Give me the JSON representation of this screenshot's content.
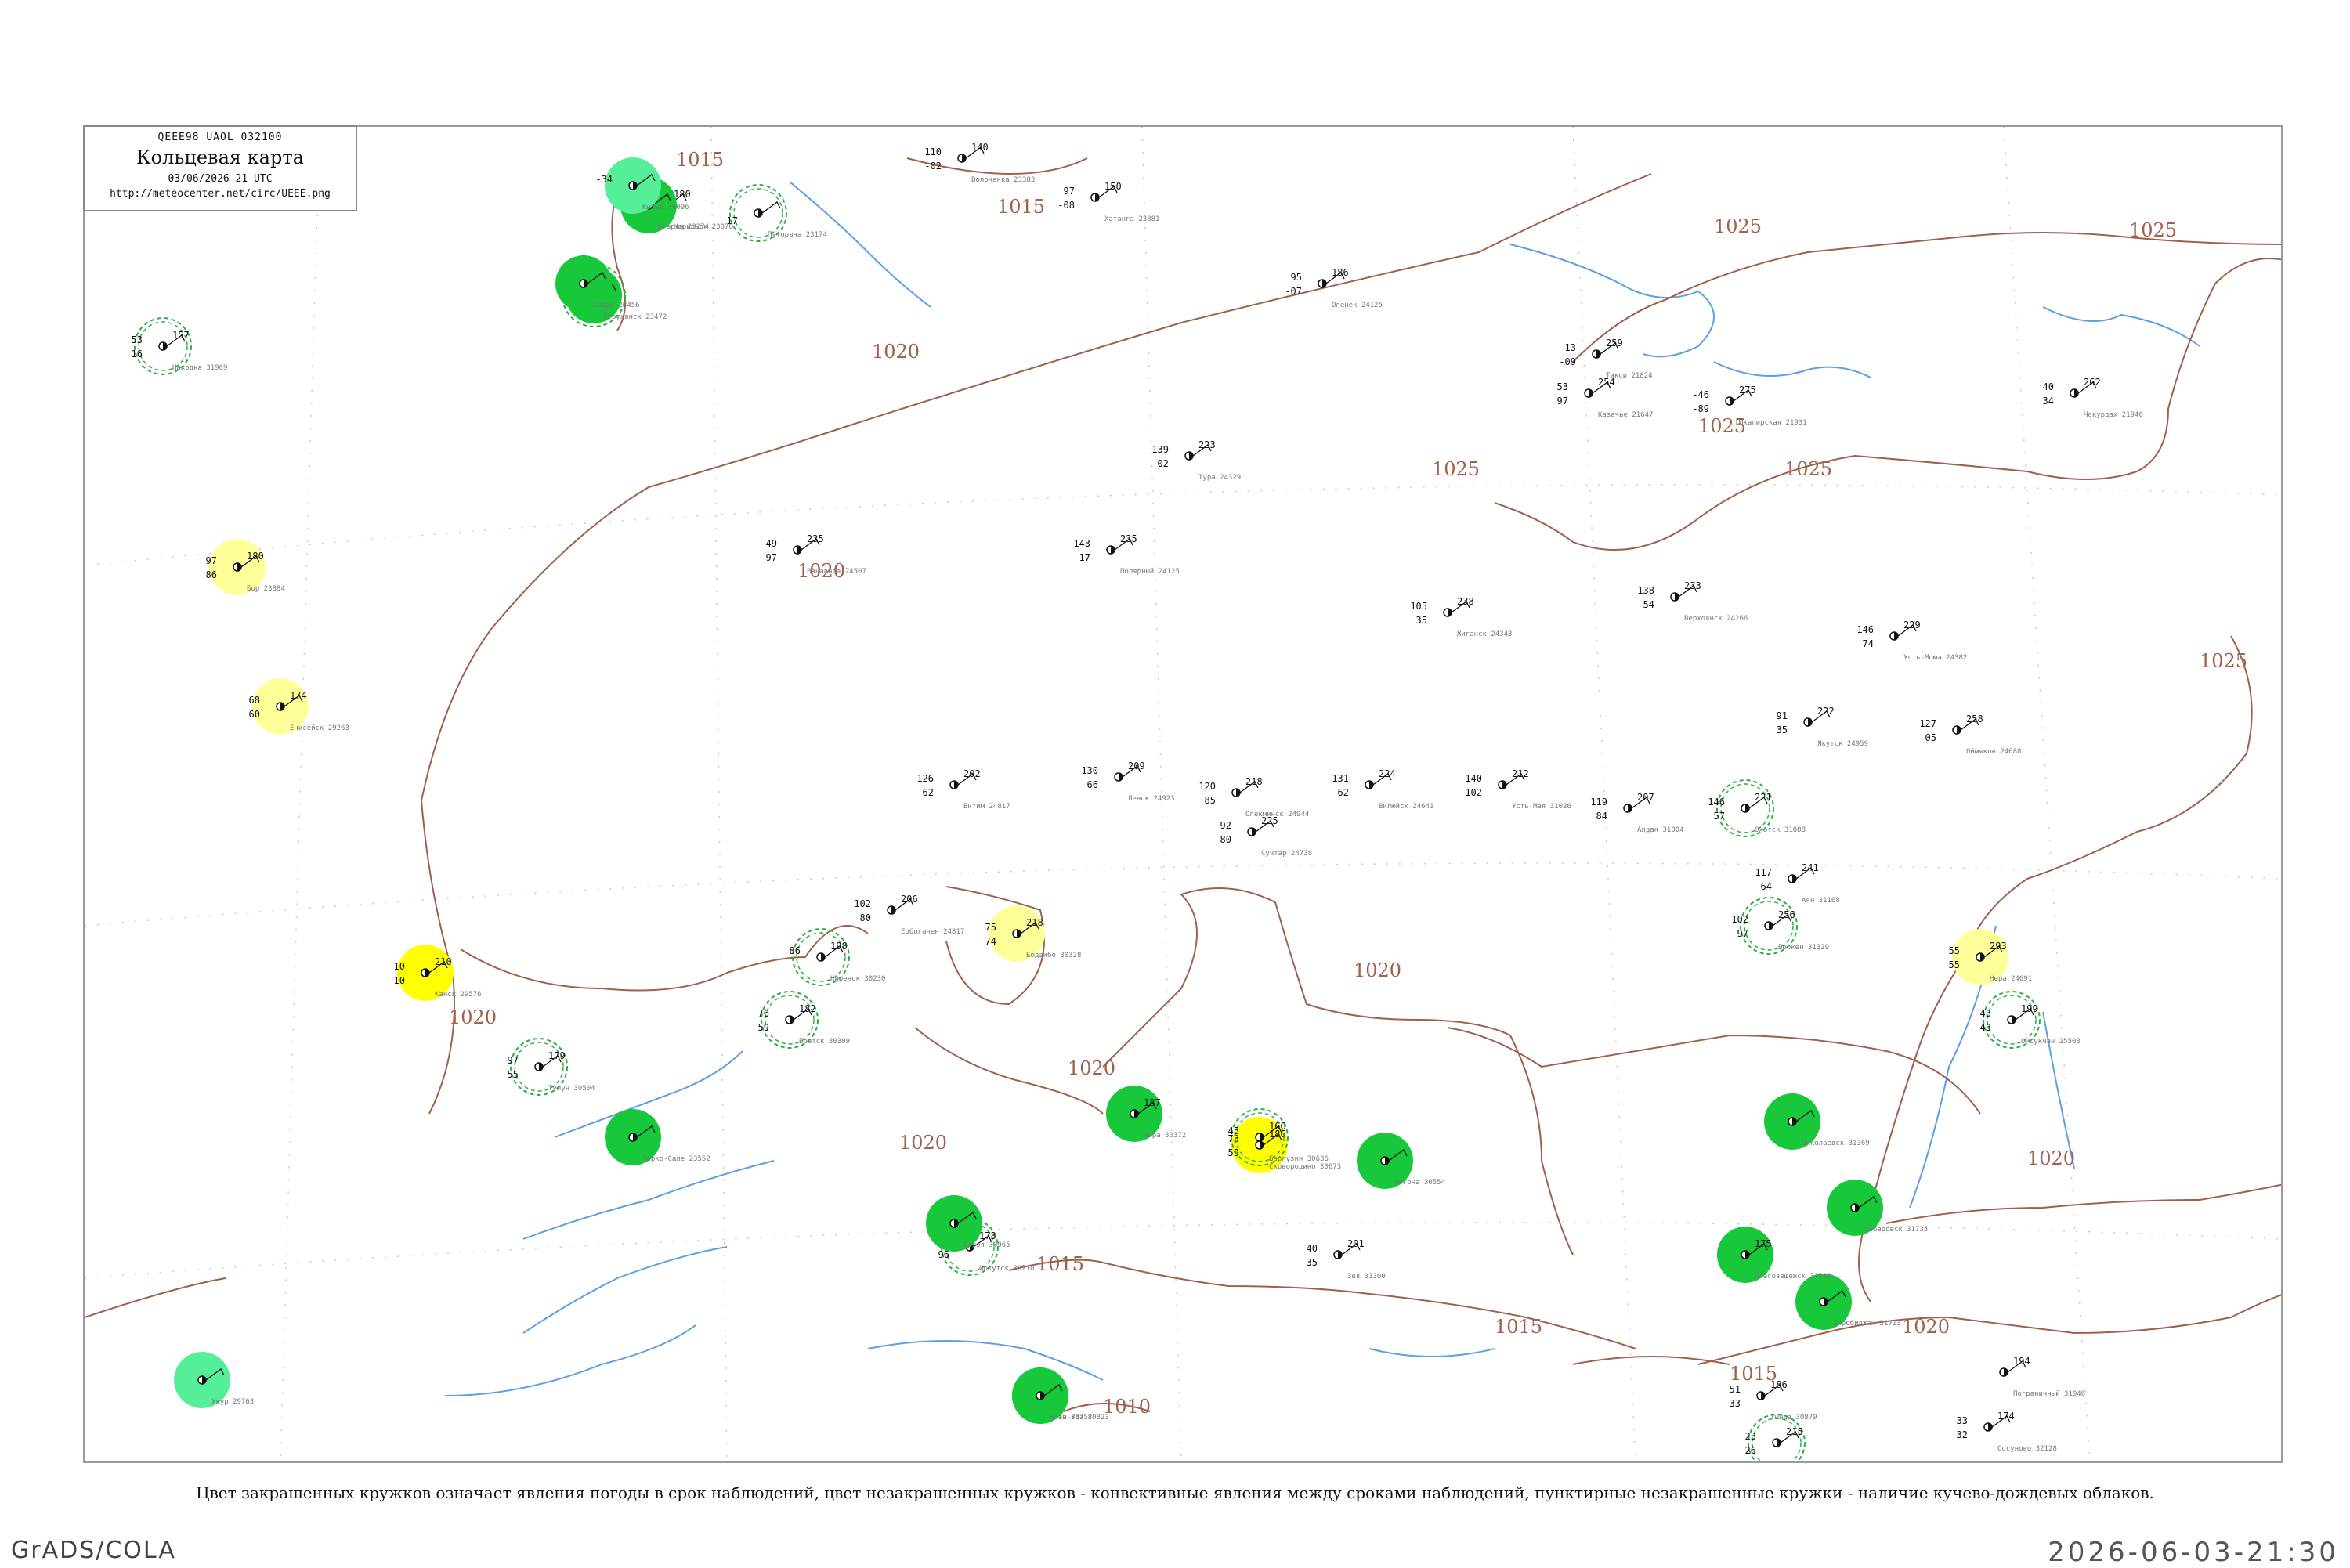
{
  "header": {
    "codes": "QEEE98  UAOL  032100",
    "title": "Кольцевая карта",
    "datetime": "03/06/2026 21 UTC",
    "url": "http://meteocenter.net/circ/UEEE.png"
  },
  "footnote": "Цвет закрашенных кружков означает явления погоды в срок наблюдений, цвет незакрашенных кружков - конвективные явления между сроками наблюдений, пунктирные незакрашенные кружки - наличие кучево-дождевых облаков.",
  "footer": {
    "left": "GrADS/COLA",
    "right": "2026-06-03-21:30"
  },
  "colors": {
    "isobar": "#a0604c",
    "coast": "#5aa0e6",
    "fill_green": "#16c83a",
    "fill_yellow": "#ffff00",
    "fill_pale_yellow": "#ffff9a",
    "fill_light_green": "#55ee99",
    "ring_green": "#2ab040",
    "grid": "#c8c8c8"
  },
  "isobar_labels": [
    {
      "value": "1015"
    },
    {
      "value": "1015"
    },
    {
      "value": "1020"
    },
    {
      "value": "1020"
    },
    {
      "value": "1020"
    },
    {
      "value": "1020"
    },
    {
      "value": "1020"
    },
    {
      "value": "1020"
    },
    {
      "value": "1020"
    },
    {
      "value": "1025"
    },
    {
      "value": "1025"
    },
    {
      "value": "1025"
    },
    {
      "value": "1025"
    },
    {
      "value": "1025"
    },
    {
      "value": "1025"
    },
    {
      "value": "1020"
    },
    {
      "value": "1015"
    },
    {
      "value": "1015"
    },
    {
      "value": "1015"
    },
    {
      "value": "1010"
    }
  ],
  "stations": [
    {
      "name": "Путорана 23174",
      "p": "",
      "t": "",
      "td": "17",
      "circle": "ring",
      "phen": "fog"
    },
    {
      "name": "Волочанка 23383",
      "p": "140",
      "t": "110",
      "td": "-02",
      "circle": "none",
      "phen": ""
    },
    {
      "name": "Хатанга 23881",
      "p": "150",
      "t": "97",
      "td": "-08",
      "circle": "none",
      "phen": ""
    },
    {
      "name": "Норильск 23078",
      "p": "180",
      "t": "43",
      "td": "40",
      "circle": "none",
      "phen": ""
    },
    {
      "name": "Игарка 23274",
      "p": "",
      "t": "",
      "td": "",
      "circle": "fill-green",
      "phen": "rain"
    },
    {
      "name": "Туруханск 23472",
      "p": "",
      "t": "",
      "td": "",
      "circle": "fill-green-ring",
      "phen": "rain"
    },
    {
      "name": "Ванавара 24507",
      "p": "235",
      "t": "49",
      "td": "97",
      "circle": "none",
      "phen": ""
    },
    {
      "name": "Тура 24329",
      "p": "223",
      "t": "139",
      "td": "-02",
      "circle": "none",
      "phen": ""
    },
    {
      "name": "Полярный 24125",
      "p": "235",
      "t": "143",
      "td": "-17",
      "circle": "none",
      "phen": ""
    },
    {
      "name": "Оленек 24125",
      "p": "186",
      "t": "95",
      "td": "-07",
      "circle": "none",
      "phen": ""
    },
    {
      "name": "Жиганск 24343",
      "p": "238",
      "t": "105",
      "td": "35",
      "circle": "none",
      "phen": ""
    },
    {
      "name": "Верхоянск 24266",
      "p": "233",
      "t": "138",
      "td": "54",
      "circle": "none",
      "phen": ""
    },
    {
      "name": "Тикси 21824",
      "p": "259",
      "t": "13",
      "td": "-09",
      "circle": "none",
      "phen": ""
    },
    {
      "name": "Казачье 21647",
      "p": "254",
      "t": "53",
      "td": "97",
      "circle": "none",
      "phen": ""
    },
    {
      "name": "Юкагирская 21931",
      "p": "275",
      "t": "-46",
      "td": "-89",
      "circle": "none",
      "phen": ""
    },
    {
      "name": "Чокурдах 21946",
      "p": "262",
      "t": "40",
      "td": "34",
      "circle": "none",
      "phen": ""
    },
    {
      "name": "Усть-Мома 24382",
      "p": "229",
      "t": "146",
      "td": "74",
      "circle": "none",
      "phen": ""
    },
    {
      "name": "Оймякон 24688",
      "p": "258",
      "t": "127",
      "td": "05",
      "circle": "none",
      "phen": ""
    },
    {
      "name": "Якутск 24959",
      "p": "222",
      "t": "91",
      "td": "35",
      "circle": "none",
      "phen": ""
    },
    {
      "name": "Сунтар 24738",
      "p": "225",
      "t": "92",
      "td": "80",
      "circle": "none",
      "phen": ""
    },
    {
      "name": "Витим 24817",
      "p": "202",
      "t": "126",
      "td": "62",
      "circle": "none",
      "phen": ""
    },
    {
      "name": "Ленск 24923",
      "p": "209",
      "t": "130",
      "td": "66",
      "circle": "none",
      "phen": ""
    },
    {
      "name": "Олекминск 24944",
      "p": "218",
      "t": "120",
      "td": "85",
      "circle": "none",
      "phen": ""
    },
    {
      "name": "Вилюйск 24641",
      "p": "224",
      "t": "131",
      "td": "62",
      "circle": "none",
      "phen": ""
    },
    {
      "name": "Усть-Мая 31026",
      "p": "212",
      "t": "140",
      "td": "102",
      "circle": "none",
      "phen": ""
    },
    {
      "name": "Алдан 31004",
      "p": "207",
      "t": "119",
      "td": "84",
      "circle": "none",
      "phen": ""
    },
    {
      "name": "Охотск 31088",
      "p": "221",
      "t": "146",
      "td": "57",
      "circle": "ring",
      "phen": "ts"
    },
    {
      "name": "Аян 31168",
      "p": "241",
      "t": "117",
      "td": "64",
      "circle": "none",
      "phen": ""
    },
    {
      "name": "Брокен 31329",
      "p": "256",
      "t": "102",
      "td": "97",
      "circle": "ring",
      "phen": "ts"
    },
    {
      "name": "Нера 24691",
      "p": "293",
      "t": "55",
      "td": "55",
      "circle": "fill-pale-yellow",
      "phen": "shower"
    },
    {
      "name": "Омсукчан 25503",
      "p": "199",
      "t": "43",
      "td": "43",
      "circle": "ring",
      "phen": "ts"
    },
    {
      "name": "Николаевск 31369",
      "p": "",
      "t": "",
      "td": "",
      "circle": "fill-green",
      "phen": "rain"
    },
    {
      "name": "Хабаровск 31735",
      "p": "",
      "t": "",
      "td": "",
      "circle": "fill-green",
      "phen": "rain"
    },
    {
      "name": "Биробиджан 31713",
      "p": "",
      "t": "",
      "td": "",
      "circle": "fill-green",
      "phen": "rain"
    },
    {
      "name": "Сковородино 30673",
      "p": "186",
      "t": "73",
      "td": "59",
      "circle": "fill-yellow",
      "phen": "shower"
    },
    {
      "name": "Могоча 30554",
      "p": "",
      "t": "",
      "td": "",
      "circle": "fill-green",
      "phen": "rain"
    },
    {
      "name": "Чара 30372",
      "p": "187",
      "t": "",
      "td": "",
      "circle": "fill-green",
      "phen": "rain"
    },
    {
      "name": "Бодайбо 30328",
      "p": "218",
      "t": "75",
      "td": "74",
      "circle": "fill-pale-yellow",
      "phen": "shower"
    },
    {
      "name": "Киренск 30230",
      "p": "198",
      "t": "86",
      "td": "",
      "circle": "ring",
      "phen": "ts"
    },
    {
      "name": "Ербогачен 24817",
      "p": "206",
      "t": "102",
      "td": "80",
      "circle": "none",
      "phen": ""
    },
    {
      "name": "Братск 30309",
      "p": "182",
      "t": "76",
      "td": "59",
      "circle": "ring",
      "phen": "ts"
    },
    {
      "name": "Тулун 30504",
      "p": "179",
      "t": "97",
      "td": "55",
      "circle": "ring",
      "phen": "ts"
    },
    {
      "name": "Енисейск 29263",
      "p": "174",
      "t": "68",
      "td": "60",
      "circle": "fill-pale-yellow",
      "phen": "shower"
    },
    {
      "name": "Бор 23884",
      "p": "180",
      "t": "97",
      "td": "86",
      "circle": "fill-pale-yellow",
      "phen": "shower"
    },
    {
      "name": "Канск 29576",
      "p": "210",
      "t": "10",
      "td": "10",
      "circle": "fill-yellow",
      "phen": "shower"
    },
    {
      "name": "Ужур 29763",
      "p": "",
      "t": "",
      "td": "",
      "circle": "fill-light-green",
      "phen": "rain"
    },
    {
      "name": "Кызыл 36096",
      "p": "",
      "t": "-34",
      "td": "",
      "circle": "fill-light-green",
      "phen": "rain"
    },
    {
      "name": "Хадыр 23456",
      "p": "",
      "t": "",
      "td": "",
      "circle": "fill-green",
      "phen": "rain"
    },
    {
      "name": "Тарко-Сале 23552",
      "p": "",
      "t": "",
      "td": "",
      "circle": "fill-green",
      "phen": "rain"
    },
    {
      "name": "Иркутск 30710",
      "p": "173",
      "t": "84",
      "td": "96",
      "circle": "ring",
      "phen": "ts"
    },
    {
      "name": "Улан-Удэ 30823",
      "p": "",
      "t": "",
      "td": "",
      "circle": "fill-green",
      "phen": "rain"
    },
    {
      "name": "Чита 30758",
      "p": "",
      "t": "",
      "td": "",
      "circle": "fill-green",
      "phen": "rain"
    },
    {
      "name": "Борзя 30965",
      "p": "",
      "t": "",
      "td": "",
      "circle": "fill-green",
      "phen": "rain"
    },
    {
      "name": "Баргузин 30636",
      "p": "166",
      "t": "45",
      "td": "",
      "circle": "ring",
      "phen": "ts"
    },
    {
      "name": "Благовещенск 31510",
      "p": "175",
      "t": "",
      "td": "",
      "circle": "fill-green",
      "phen": "rain"
    },
    {
      "name": "Зея 31300",
      "p": "201",
      "t": "40",
      "td": "35",
      "circle": "none",
      "phen": ""
    },
    {
      "name": "Тында 30879",
      "p": "186",
      "t": "51",
      "td": "33",
      "circle": "none",
      "phen": ""
    },
    {
      "name": "Дальнереченск 31909",
      "p": "215",
      "t": "23",
      "td": "26",
      "circle": "ring",
      "phen": "ts"
    },
    {
      "name": "Пограничный 31946",
      "p": "194",
      "t": "",
      "td": "",
      "circle": "none",
      "phen": ""
    },
    {
      "name": "Сосуново 32128",
      "p": "174",
      "t": "33",
      "td": "32",
      "circle": "none",
      "phen": ""
    },
    {
      "name": "Находка 31969",
      "p": "157",
      "t": "53",
      "td": "16",
      "circle": "ring",
      "phen": "ts"
    }
  ]
}
